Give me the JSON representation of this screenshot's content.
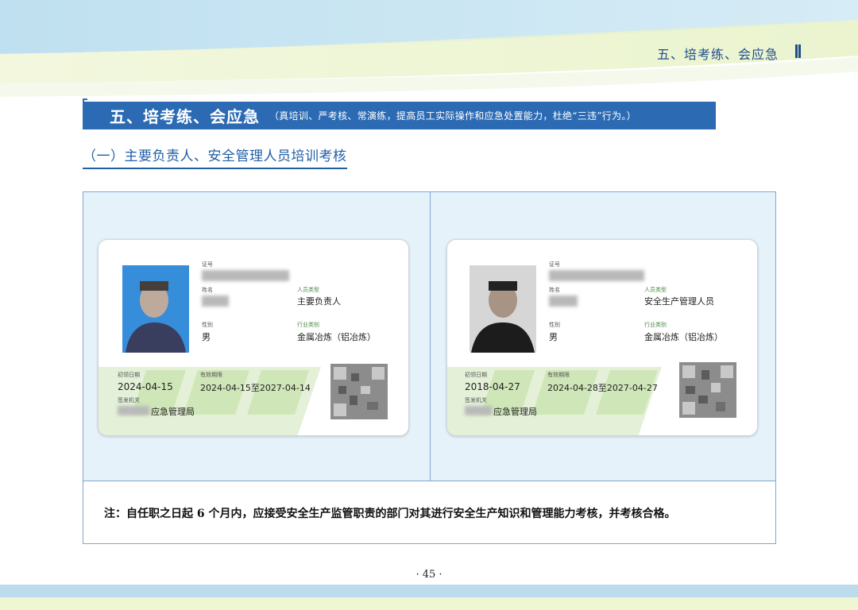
{
  "header": {
    "running_title": "五、培考练、会应急"
  },
  "section": {
    "title": "五、培考练、会应急",
    "subtitle": "（真培训、严考核、常演练，提高员工实际操作和应急处置能力，杜绝“三违”行为。）"
  },
  "subsection": {
    "title": "（一）主要负责人、安全管理人员培训考核"
  },
  "cards": [
    {
      "id_label": "证号",
      "name_label": "姓名",
      "type_label": "人员类型",
      "type_value": "主要负责人",
      "gender_label": "性别",
      "gender_value": "男",
      "industry_label": "行业类别",
      "industry_value": "金属冶炼（铝冶炼）",
      "first_date_label": "初领日期",
      "first_date_value": "2024-04-15",
      "valid_label": "有效期限",
      "valid_value": "2024-04-15至2027-04-14",
      "issuer_label": "签发机关",
      "issuer_value": "应急管理局"
    },
    {
      "id_label": "证号",
      "name_label": "姓名",
      "type_label": "人员类型",
      "type_value": "安全生产管理人员",
      "gender_label": "性别",
      "gender_value": "男",
      "industry_label": "行业类别",
      "industry_value": "金属冶炼（铝冶炼）",
      "first_date_label": "初领日期",
      "first_date_value": "2018-04-27",
      "valid_label": "有效期限",
      "valid_value": "2024-04-28至2027-04-27",
      "issuer_label": "签发机关",
      "issuer_value": "应急管理局"
    }
  ],
  "note": "注：自任职之日起 6 个月内，应接受安全生产监管职责的部门对其进行安全生产知识和管理能力考核，并考核合格。",
  "page_number": "· 45 ·",
  "colors": {
    "banner": "#2c6bb4",
    "heading_blue": "#1f5ea8",
    "panel_bg": "#e6f2fa",
    "card_green": "#4e8a4a"
  }
}
